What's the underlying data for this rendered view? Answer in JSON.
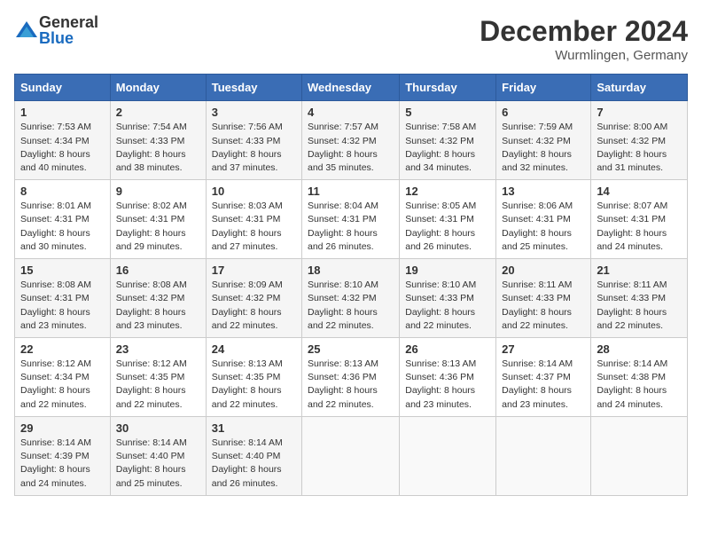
{
  "header": {
    "logo_general": "General",
    "logo_blue": "Blue",
    "month_title": "December 2024",
    "location": "Wurmlingen, Germany"
  },
  "days_of_week": [
    "Sunday",
    "Monday",
    "Tuesday",
    "Wednesday",
    "Thursday",
    "Friday",
    "Saturday"
  ],
  "weeks": [
    [
      {
        "day": "1",
        "sunrise": "Sunrise: 7:53 AM",
        "sunset": "Sunset: 4:34 PM",
        "daylight": "Daylight: 8 hours and 40 minutes."
      },
      {
        "day": "2",
        "sunrise": "Sunrise: 7:54 AM",
        "sunset": "Sunset: 4:33 PM",
        "daylight": "Daylight: 8 hours and 38 minutes."
      },
      {
        "day": "3",
        "sunrise": "Sunrise: 7:56 AM",
        "sunset": "Sunset: 4:33 PM",
        "daylight": "Daylight: 8 hours and 37 minutes."
      },
      {
        "day": "4",
        "sunrise": "Sunrise: 7:57 AM",
        "sunset": "Sunset: 4:32 PM",
        "daylight": "Daylight: 8 hours and 35 minutes."
      },
      {
        "day": "5",
        "sunrise": "Sunrise: 7:58 AM",
        "sunset": "Sunset: 4:32 PM",
        "daylight": "Daylight: 8 hours and 34 minutes."
      },
      {
        "day": "6",
        "sunrise": "Sunrise: 7:59 AM",
        "sunset": "Sunset: 4:32 PM",
        "daylight": "Daylight: 8 hours and 32 minutes."
      },
      {
        "day": "7",
        "sunrise": "Sunrise: 8:00 AM",
        "sunset": "Sunset: 4:32 PM",
        "daylight": "Daylight: 8 hours and 31 minutes."
      }
    ],
    [
      {
        "day": "8",
        "sunrise": "Sunrise: 8:01 AM",
        "sunset": "Sunset: 4:31 PM",
        "daylight": "Daylight: 8 hours and 30 minutes."
      },
      {
        "day": "9",
        "sunrise": "Sunrise: 8:02 AM",
        "sunset": "Sunset: 4:31 PM",
        "daylight": "Daylight: 8 hours and 29 minutes."
      },
      {
        "day": "10",
        "sunrise": "Sunrise: 8:03 AM",
        "sunset": "Sunset: 4:31 PM",
        "daylight": "Daylight: 8 hours and 27 minutes."
      },
      {
        "day": "11",
        "sunrise": "Sunrise: 8:04 AM",
        "sunset": "Sunset: 4:31 PM",
        "daylight": "Daylight: 8 hours and 26 minutes."
      },
      {
        "day": "12",
        "sunrise": "Sunrise: 8:05 AM",
        "sunset": "Sunset: 4:31 PM",
        "daylight": "Daylight: 8 hours and 26 minutes."
      },
      {
        "day": "13",
        "sunrise": "Sunrise: 8:06 AM",
        "sunset": "Sunset: 4:31 PM",
        "daylight": "Daylight: 8 hours and 25 minutes."
      },
      {
        "day": "14",
        "sunrise": "Sunrise: 8:07 AM",
        "sunset": "Sunset: 4:31 PM",
        "daylight": "Daylight: 8 hours and 24 minutes."
      }
    ],
    [
      {
        "day": "15",
        "sunrise": "Sunrise: 8:08 AM",
        "sunset": "Sunset: 4:31 PM",
        "daylight": "Daylight: 8 hours and 23 minutes."
      },
      {
        "day": "16",
        "sunrise": "Sunrise: 8:08 AM",
        "sunset": "Sunset: 4:32 PM",
        "daylight": "Daylight: 8 hours and 23 minutes."
      },
      {
        "day": "17",
        "sunrise": "Sunrise: 8:09 AM",
        "sunset": "Sunset: 4:32 PM",
        "daylight": "Daylight: 8 hours and 22 minutes."
      },
      {
        "day": "18",
        "sunrise": "Sunrise: 8:10 AM",
        "sunset": "Sunset: 4:32 PM",
        "daylight": "Daylight: 8 hours and 22 minutes."
      },
      {
        "day": "19",
        "sunrise": "Sunrise: 8:10 AM",
        "sunset": "Sunset: 4:33 PM",
        "daylight": "Daylight: 8 hours and 22 minutes."
      },
      {
        "day": "20",
        "sunrise": "Sunrise: 8:11 AM",
        "sunset": "Sunset: 4:33 PM",
        "daylight": "Daylight: 8 hours and 22 minutes."
      },
      {
        "day": "21",
        "sunrise": "Sunrise: 8:11 AM",
        "sunset": "Sunset: 4:33 PM",
        "daylight": "Daylight: 8 hours and 22 minutes."
      }
    ],
    [
      {
        "day": "22",
        "sunrise": "Sunrise: 8:12 AM",
        "sunset": "Sunset: 4:34 PM",
        "daylight": "Daylight: 8 hours and 22 minutes."
      },
      {
        "day": "23",
        "sunrise": "Sunrise: 8:12 AM",
        "sunset": "Sunset: 4:35 PM",
        "daylight": "Daylight: 8 hours and 22 minutes."
      },
      {
        "day": "24",
        "sunrise": "Sunrise: 8:13 AM",
        "sunset": "Sunset: 4:35 PM",
        "daylight": "Daylight: 8 hours and 22 minutes."
      },
      {
        "day": "25",
        "sunrise": "Sunrise: 8:13 AM",
        "sunset": "Sunset: 4:36 PM",
        "daylight": "Daylight: 8 hours and 22 minutes."
      },
      {
        "day": "26",
        "sunrise": "Sunrise: 8:13 AM",
        "sunset": "Sunset: 4:36 PM",
        "daylight": "Daylight: 8 hours and 23 minutes."
      },
      {
        "day": "27",
        "sunrise": "Sunrise: 8:14 AM",
        "sunset": "Sunset: 4:37 PM",
        "daylight": "Daylight: 8 hours and 23 minutes."
      },
      {
        "day": "28",
        "sunrise": "Sunrise: 8:14 AM",
        "sunset": "Sunset: 4:38 PM",
        "daylight": "Daylight: 8 hours and 24 minutes."
      }
    ],
    [
      {
        "day": "29",
        "sunrise": "Sunrise: 8:14 AM",
        "sunset": "Sunset: 4:39 PM",
        "daylight": "Daylight: 8 hours and 24 minutes."
      },
      {
        "day": "30",
        "sunrise": "Sunrise: 8:14 AM",
        "sunset": "Sunset: 4:40 PM",
        "daylight": "Daylight: 8 hours and 25 minutes."
      },
      {
        "day": "31",
        "sunrise": "Sunrise: 8:14 AM",
        "sunset": "Sunset: 4:40 PM",
        "daylight": "Daylight: 8 hours and 26 minutes."
      },
      null,
      null,
      null,
      null
    ]
  ]
}
